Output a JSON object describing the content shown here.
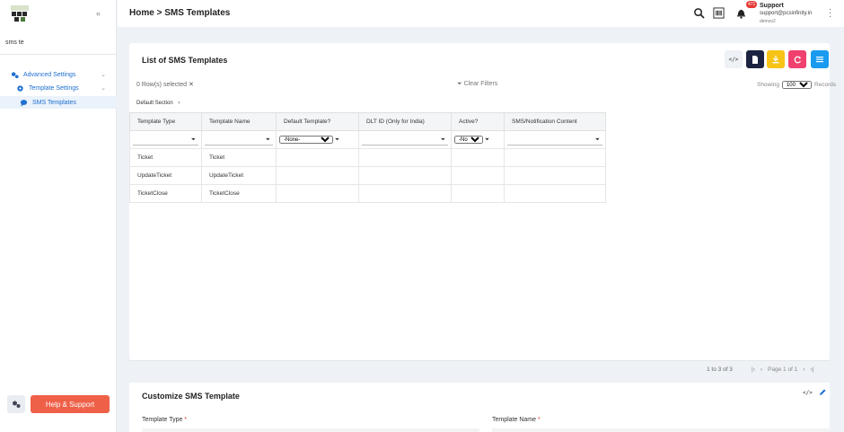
{
  "sidebar": {
    "search_value": "sms te",
    "items": [
      {
        "label": "Advanced Settings",
        "icon": "gears-icon"
      },
      {
        "label": "Template Settings",
        "icon": "gear-icon"
      },
      {
        "label": "SMS Templates",
        "icon": "chat-icon"
      }
    ],
    "help_label": "Help & Support"
  },
  "header": {
    "breadcrumb_home": "Home",
    "breadcrumb_sep": " > ",
    "breadcrumb_page": "SMS Templates",
    "notif_count": "471",
    "user_name": "Support",
    "user_email": "support@pcsinfinity.in",
    "user_role": "demov2"
  },
  "list": {
    "title": "List of SMS Templates",
    "rows_selected": "0 Row(s) selected",
    "clear_filters": "Clear Filters",
    "showing_label": "Showing",
    "page_size": "100",
    "records_label": "Records",
    "default_section": "Default Section",
    "columns": [
      "Template Type",
      "Template Name",
      "Default Template?",
      "DLT ID (Only for India)",
      "Active?",
      "SMS/Notification Content"
    ],
    "filter_none": "-None-",
    "rows": [
      [
        "Ticket",
        "Ticket",
        "",
        "",
        "",
        ""
      ],
      [
        "UpdateTicket",
        "UpdateTicket",
        "",
        "",
        "",
        ""
      ],
      [
        "TicketClose",
        "TicketClose",
        "",
        "",
        "",
        ""
      ]
    ],
    "record_range": "1 to 3 of 3",
    "page_label": "Page 1 of 1"
  },
  "customize": {
    "title": "Customize SMS Template",
    "template_type_label": "Template Type",
    "template_name_label": "Template Name",
    "required_mark": "*"
  },
  "colors": {
    "accent": "#1f6fd0",
    "help": "#ef6048",
    "btn_dark": "#1c2340",
    "btn_yellow": "#f7c316",
    "btn_pink": "#f0416e",
    "btn_blue": "#1a9bf0"
  }
}
